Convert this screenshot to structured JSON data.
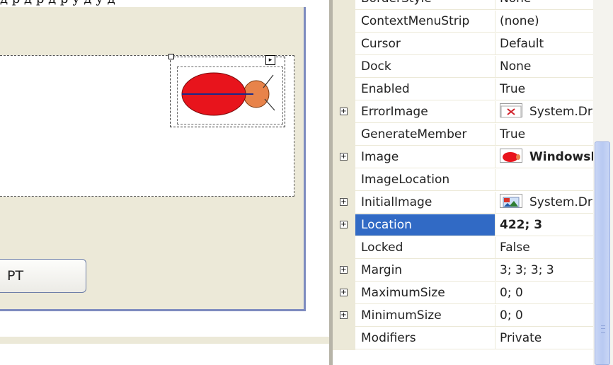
{
  "caption": {
    "text": "д    р  д        р д       р                         у     д     у             д"
  },
  "designer": {
    "button_label": "РТ",
    "picturebox_image_icon": "ladybug-image",
    "smart_tag_icon": "smart-tag-arrow-icon"
  },
  "properties": {
    "rows": [
      {
        "name": "BorderStyle",
        "value": "None",
        "expandable": false
      },
      {
        "name": "ContextMenuStrip",
        "value": "(none)",
        "expandable": false
      },
      {
        "name": "Cursor",
        "value": "Default",
        "expandable": false
      },
      {
        "name": "Dock",
        "value": "None",
        "expandable": false
      },
      {
        "name": "Enabled",
        "value": "True",
        "expandable": false
      },
      {
        "name": "ErrorImage",
        "value": "System.Drawing",
        "expandable": true,
        "thumb": "error-image-icon"
      },
      {
        "name": "GenerateMember",
        "value": "True",
        "expandable": false
      },
      {
        "name": "Image",
        "value": "WindowsForms",
        "expandable": true,
        "thumb": "ladybug-thumb-icon",
        "bold": true
      },
      {
        "name": "ImageLocation",
        "value": "",
        "expandable": false
      },
      {
        "name": "InitialImage",
        "value": "System.Drawing",
        "expandable": true,
        "thumb": "initial-image-icon"
      },
      {
        "name": "Location",
        "value": "422; 3",
        "expandable": true,
        "selected": true,
        "bold": true
      },
      {
        "name": "Locked",
        "value": "False",
        "expandable": false
      },
      {
        "name": "Margin",
        "value": "3; 3; 3; 3",
        "expandable": true
      },
      {
        "name": "MaximumSize",
        "value": "0; 0",
        "expandable": true
      },
      {
        "name": "MinimumSize",
        "value": "0; 0",
        "expandable": true
      },
      {
        "name": "Modifiers",
        "value": "Private",
        "expandable": false
      }
    ]
  },
  "colors": {
    "selection": "#316ac5",
    "form_background": "#ece9d8",
    "ladybug_body": "#e8141c",
    "ladybug_head": "#e8834a"
  }
}
